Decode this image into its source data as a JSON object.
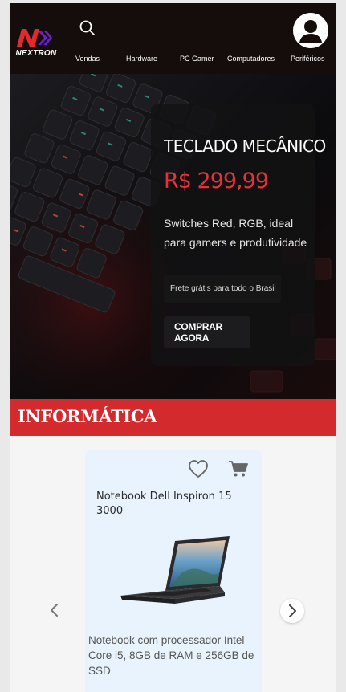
{
  "brand": {
    "name": "NEXTRON"
  },
  "nav": {
    "items": [
      {
        "label": "Vendas"
      },
      {
        "label": "Hardware"
      },
      {
        "label": "PC Gamer"
      },
      {
        "label": "Computadores"
      },
      {
        "label": "Periféricos"
      }
    ]
  },
  "icons": {
    "search": "search-icon",
    "user": "user-icon",
    "favorite": "heart-icon",
    "cart": "cart-icon",
    "prev": "chevron-left-icon",
    "next": "chevron-right-icon"
  },
  "hero": {
    "title": "TECLADO MECÂNICO",
    "price": "R$ 299,99",
    "description": "Switches Red, RGB, ideal para gamers e produtividade",
    "shipping": "Frete grátis para todo o Brasil",
    "cta_label": "COMPRAR AGORA"
  },
  "section": {
    "title": "INFORMÁTICA"
  },
  "product": {
    "name": "Notebook Dell Inspiron 15 3000",
    "description": "Notebook com processador Intel Core i5, 8GB de RAM e 256GB de SSD"
  },
  "colors": {
    "header_bg": "#150d0c",
    "accent_red": "#d32a2d",
    "price_red": "#e53238",
    "card_bg": "#e9f3fd",
    "logo_purple": "#6b1fd0"
  }
}
